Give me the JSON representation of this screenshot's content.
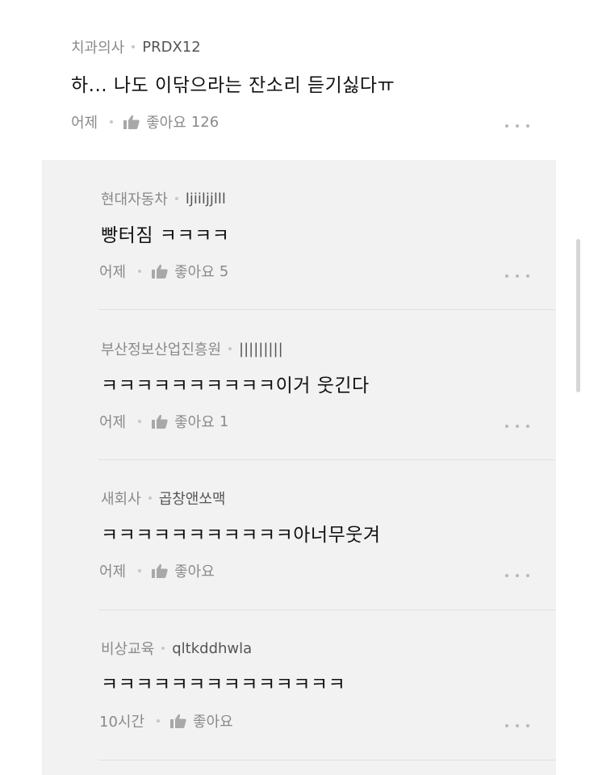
{
  "main_comment": {
    "author": "치과의사",
    "nickname": "PRDX12",
    "text": "하... 나도 이닦으라는 잔소리 듣기싫다ㅠ",
    "time": "어제",
    "like_label": "좋아요",
    "like_count": "126"
  },
  "replies": [
    {
      "author": "현대자동차",
      "nickname": "ljiiljjlll",
      "text": "빵터짐 ㅋㅋㅋㅋ",
      "time": "어제",
      "like_label": "좋아요",
      "like_count": "5"
    },
    {
      "author": "부산정보산업진흥원",
      "nickname": "|||||||||",
      "text": "ㅋㅋㅋㅋㅋㅋㅋㅋㅋㅋ이거 웃긴다",
      "time": "어제",
      "like_label": "좋아요",
      "like_count": "1"
    },
    {
      "author": "새회사",
      "nickname": "곱창앤쏘맥",
      "text": "ㅋㅋㅋㅋㅋㅋㅋㅋㅋㅋㅋ아너무웃겨",
      "time": "어제",
      "like_label": "좋아요",
      "like_count": ""
    },
    {
      "author": "비상교육",
      "nickname": "qltkddhwla",
      "text": "ㅋㅋㅋㅋㅋㅋㅋㅋㅋㅋㅋㅋㅋㅋ",
      "time": "10시간",
      "like_label": "좋아요",
      "like_count": ""
    }
  ],
  "icons": {
    "like": "thumbs-up-icon",
    "more": "more-options-icon"
  },
  "colors": {
    "reply_background": "#f2f2f2",
    "meta_text": "#8a8a8a",
    "body_text": "#111111"
  }
}
